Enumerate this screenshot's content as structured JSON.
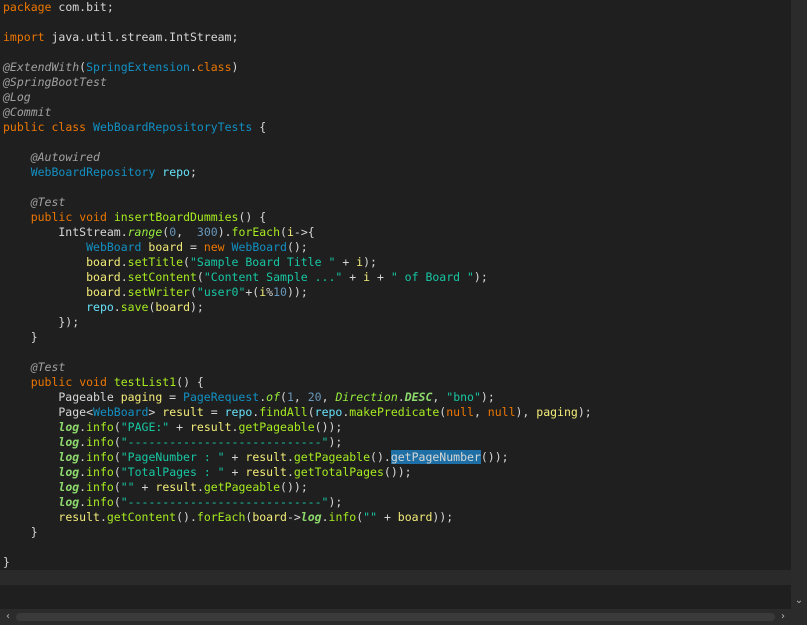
{
  "editor": {
    "lines": [
      [
        {
          "t": "package",
          "c": "kw"
        },
        {
          "t": " com.bit;"
        }
      ],
      [],
      [
        {
          "t": "import",
          "c": "kw"
        },
        {
          "t": " java.util.stream.IntStream;"
        }
      ],
      [],
      [
        {
          "t": "@ExtendWith",
          "c": "ann"
        },
        {
          "t": "("
        },
        {
          "t": "SpringExtension",
          "c": "type"
        },
        {
          "t": "."
        },
        {
          "t": "class",
          "c": "kw"
        },
        {
          "t": ")"
        }
      ],
      [
        {
          "t": "@SpringBootTest",
          "c": "ann"
        }
      ],
      [
        {
          "t": "@Log",
          "c": "ann"
        }
      ],
      [
        {
          "t": "@Commit",
          "c": "ann"
        }
      ],
      [
        {
          "t": "public",
          "c": "kw"
        },
        {
          "t": " "
        },
        {
          "t": "class",
          "c": "kw"
        },
        {
          "t": " "
        },
        {
          "t": "WebBoardRepositoryTests",
          "c": "type"
        },
        {
          "t": " {"
        }
      ],
      [],
      [
        {
          "t": "    "
        },
        {
          "t": "@Autowired",
          "c": "ann"
        }
      ],
      [
        {
          "t": "    "
        },
        {
          "t": "WebBoardRepository",
          "c": "type"
        },
        {
          "t": " "
        },
        {
          "t": "repo",
          "c": "field"
        },
        {
          "t": ";"
        }
      ],
      [],
      [
        {
          "t": "    "
        },
        {
          "t": "@Test",
          "c": "ann"
        }
      ],
      [
        {
          "t": "    "
        },
        {
          "t": "public",
          "c": "kw"
        },
        {
          "t": " "
        },
        {
          "t": "void",
          "c": "kw"
        },
        {
          "t": " "
        },
        {
          "t": "insertBoardDummies",
          "c": "method"
        },
        {
          "t": "() {"
        }
      ],
      [
        {
          "t": "        IntStream."
        },
        {
          "t": "range",
          "c": "staticm"
        },
        {
          "t": "("
        },
        {
          "t": "0",
          "c": "num"
        },
        {
          "t": ",  "
        },
        {
          "t": "300",
          "c": "num"
        },
        {
          "t": ")."
        },
        {
          "t": "forEach",
          "c": "method"
        },
        {
          "t": "("
        },
        {
          "t": "i",
          "c": "localvar"
        },
        {
          "t": "->{"
        }
      ],
      [
        {
          "t": "            "
        },
        {
          "t": "WebBoard",
          "c": "type"
        },
        {
          "t": " "
        },
        {
          "t": "board",
          "c": "localvar"
        },
        {
          "t": " = "
        },
        {
          "t": "new",
          "c": "kw"
        },
        {
          "t": " "
        },
        {
          "t": "WebBoard",
          "c": "type"
        },
        {
          "t": "();"
        }
      ],
      [
        {
          "t": "            "
        },
        {
          "t": "board",
          "c": "localvar"
        },
        {
          "t": "."
        },
        {
          "t": "setTitle",
          "c": "method"
        },
        {
          "t": "("
        },
        {
          "t": "\"Sample Board Title \"",
          "c": "str"
        },
        {
          "t": " + "
        },
        {
          "t": "i",
          "c": "localvar"
        },
        {
          "t": ");"
        }
      ],
      [
        {
          "t": "            "
        },
        {
          "t": "board",
          "c": "localvar"
        },
        {
          "t": "."
        },
        {
          "t": "setContent",
          "c": "method"
        },
        {
          "t": "("
        },
        {
          "t": "\"Content Sample ...\"",
          "c": "str"
        },
        {
          "t": " + "
        },
        {
          "t": "i",
          "c": "localvar"
        },
        {
          "t": " + "
        },
        {
          "t": "\" of Board \"",
          "c": "str"
        },
        {
          "t": ");"
        }
      ],
      [
        {
          "t": "            "
        },
        {
          "t": "board",
          "c": "localvar"
        },
        {
          "t": "."
        },
        {
          "t": "setWriter",
          "c": "method"
        },
        {
          "t": "("
        },
        {
          "t": "\"user0\"",
          "c": "str"
        },
        {
          "t": "+("
        },
        {
          "t": "i",
          "c": "localvar"
        },
        {
          "t": "%"
        },
        {
          "t": "10",
          "c": "num"
        },
        {
          "t": "));"
        }
      ],
      [
        {
          "t": "            "
        },
        {
          "t": "repo",
          "c": "field"
        },
        {
          "t": "."
        },
        {
          "t": "save",
          "c": "method"
        },
        {
          "t": "("
        },
        {
          "t": "board",
          "c": "localvar"
        },
        {
          "t": ");"
        }
      ],
      [
        {
          "t": "        });"
        }
      ],
      [
        {
          "t": "    }"
        }
      ],
      [],
      [
        {
          "t": "    "
        },
        {
          "t": "@Test",
          "c": "ann"
        }
      ],
      [
        {
          "t": "    "
        },
        {
          "t": "public",
          "c": "kw"
        },
        {
          "t": " "
        },
        {
          "t": "void",
          "c": "kw"
        },
        {
          "t": " "
        },
        {
          "t": "testList1",
          "c": "method"
        },
        {
          "t": "() {"
        }
      ],
      [
        {
          "t": "        Pageable "
        },
        {
          "t": "paging",
          "c": "localvar"
        },
        {
          "t": " = "
        },
        {
          "t": "PageRequest",
          "c": "type"
        },
        {
          "t": "."
        },
        {
          "t": "of",
          "c": "staticm"
        },
        {
          "t": "("
        },
        {
          "t": "1",
          "c": "num"
        },
        {
          "t": ", "
        },
        {
          "t": "20",
          "c": "num"
        },
        {
          "t": ", "
        },
        {
          "t": "Direction",
          "c": "staticm"
        },
        {
          "t": "."
        },
        {
          "t": "DESC",
          "c": "staticf"
        },
        {
          "t": ", "
        },
        {
          "t": "\"bno\"",
          "c": "str"
        },
        {
          "t": ");"
        }
      ],
      [
        {
          "t": "        Page<"
        },
        {
          "t": "WebBoard",
          "c": "type"
        },
        {
          "t": "> "
        },
        {
          "t": "result",
          "c": "localvar"
        },
        {
          "t": " = "
        },
        {
          "t": "repo",
          "c": "field"
        },
        {
          "t": "."
        },
        {
          "t": "findAll",
          "c": "method"
        },
        {
          "t": "("
        },
        {
          "t": "repo",
          "c": "field"
        },
        {
          "t": "."
        },
        {
          "t": "makePredicate",
          "c": "method"
        },
        {
          "t": "("
        },
        {
          "t": "null",
          "c": "kw"
        },
        {
          "t": ", "
        },
        {
          "t": "null",
          "c": "kw"
        },
        {
          "t": "), "
        },
        {
          "t": "paging",
          "c": "localvar"
        },
        {
          "t": ");"
        }
      ],
      [
        {
          "t": "        "
        },
        {
          "t": "log",
          "c": "logf"
        },
        {
          "t": "."
        },
        {
          "t": "info",
          "c": "method"
        },
        {
          "t": "("
        },
        {
          "t": "\"PAGE:\"",
          "c": "str"
        },
        {
          "t": " + "
        },
        {
          "t": "result",
          "c": "localvar"
        },
        {
          "t": "."
        },
        {
          "t": "getPageable",
          "c": "method"
        },
        {
          "t": "());"
        }
      ],
      [
        {
          "t": "        "
        },
        {
          "t": "log",
          "c": "logf"
        },
        {
          "t": "."
        },
        {
          "t": "info",
          "c": "method"
        },
        {
          "t": "("
        },
        {
          "t": "\"----------------------------\"",
          "c": "str"
        },
        {
          "t": ");"
        }
      ],
      [
        {
          "t": "        "
        },
        {
          "t": "log",
          "c": "logf"
        },
        {
          "t": "."
        },
        {
          "t": "info",
          "c": "method"
        },
        {
          "t": "("
        },
        {
          "t": "\"PageNumber : \"",
          "c": "str"
        },
        {
          "t": " + "
        },
        {
          "t": "result",
          "c": "localvar"
        },
        {
          "t": "."
        },
        {
          "t": "getPageable",
          "c": "method"
        },
        {
          "t": "()."
        },
        {
          "t": "getPageNumber",
          "c": "hl"
        },
        {
          "t": "());"
        }
      ],
      [
        {
          "t": "        "
        },
        {
          "t": "log",
          "c": "logf"
        },
        {
          "t": "."
        },
        {
          "t": "info",
          "c": "method"
        },
        {
          "t": "("
        },
        {
          "t": "\"TotalPages : \"",
          "c": "str"
        },
        {
          "t": " + "
        },
        {
          "t": "result",
          "c": "localvar"
        },
        {
          "t": "."
        },
        {
          "t": "getTotalPages",
          "c": "method"
        },
        {
          "t": "());"
        }
      ],
      [
        {
          "t": "        "
        },
        {
          "t": "log",
          "c": "logf"
        },
        {
          "t": "."
        },
        {
          "t": "info",
          "c": "method"
        },
        {
          "t": "("
        },
        {
          "t": "\"\"",
          "c": "str"
        },
        {
          "t": " + "
        },
        {
          "t": "result",
          "c": "localvar"
        },
        {
          "t": "."
        },
        {
          "t": "getPageable",
          "c": "method"
        },
        {
          "t": "());"
        }
      ],
      [
        {
          "t": "        "
        },
        {
          "t": "log",
          "c": "logf"
        },
        {
          "t": "."
        },
        {
          "t": "info",
          "c": "method"
        },
        {
          "t": "("
        },
        {
          "t": "\"----------------------------\"",
          "c": "str"
        },
        {
          "t": ");"
        }
      ],
      [
        {
          "t": "        "
        },
        {
          "t": "result",
          "c": "localvar"
        },
        {
          "t": "."
        },
        {
          "t": "getContent",
          "c": "method"
        },
        {
          "t": "()."
        },
        {
          "t": "forEach",
          "c": "method"
        },
        {
          "t": "("
        },
        {
          "t": "board",
          "c": "localvar"
        },
        {
          "t": "->"
        },
        {
          "t": "log",
          "c": "logf"
        },
        {
          "t": "."
        },
        {
          "t": "info",
          "c": "method"
        },
        {
          "t": "("
        },
        {
          "t": "\"\"",
          "c": "str"
        },
        {
          "t": " + "
        },
        {
          "t": "board",
          "c": "localvar"
        },
        {
          "t": "));"
        }
      ],
      [
        {
          "t": "    }"
        }
      ],
      [],
      [
        {
          "t": "}"
        }
      ],
      []
    ],
    "current_line_index": 38
  },
  "scrollbars": {
    "down_arrow": "⌄",
    "left_arrow": "‹",
    "right_arrow": "›"
  },
  "colors": {
    "background": "#1f1f1f",
    "keyword": "#ec7600",
    "annotation": "#a0a0a0",
    "type": "#1290c3",
    "string": "#17c6a3",
    "method": "#a7ec21",
    "local_variable": "#f3ec79",
    "field": "#66e1f8",
    "selection": "#1d6fa5"
  }
}
